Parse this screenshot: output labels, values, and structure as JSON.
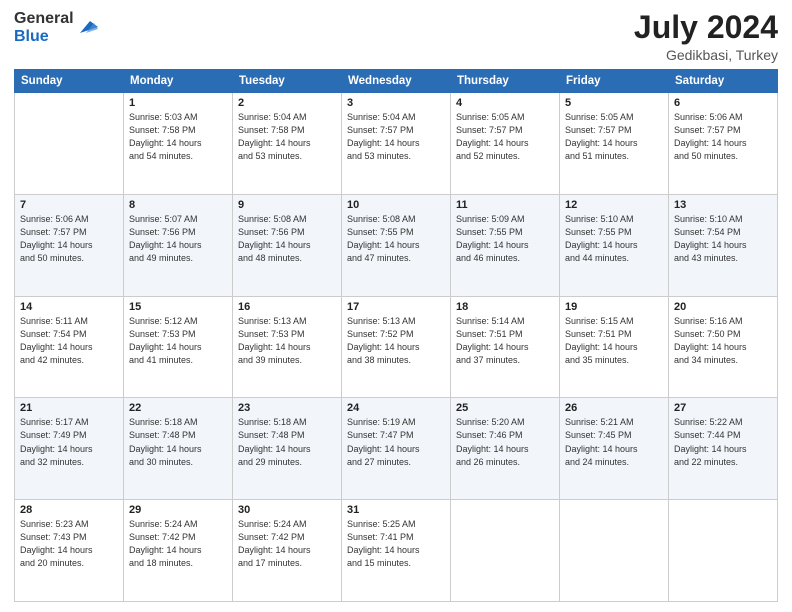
{
  "logo": {
    "general": "General",
    "blue": "Blue"
  },
  "header": {
    "month": "July 2024",
    "location": "Gedikbasi, Turkey"
  },
  "days": [
    "Sunday",
    "Monday",
    "Tuesday",
    "Wednesday",
    "Thursday",
    "Friday",
    "Saturday"
  ],
  "weeks": [
    [
      {
        "day": "",
        "info": ""
      },
      {
        "day": "1",
        "info": "Sunrise: 5:03 AM\nSunset: 7:58 PM\nDaylight: 14 hours\nand 54 minutes."
      },
      {
        "day": "2",
        "info": "Sunrise: 5:04 AM\nSunset: 7:58 PM\nDaylight: 14 hours\nand 53 minutes."
      },
      {
        "day": "3",
        "info": "Sunrise: 5:04 AM\nSunset: 7:57 PM\nDaylight: 14 hours\nand 53 minutes."
      },
      {
        "day": "4",
        "info": "Sunrise: 5:05 AM\nSunset: 7:57 PM\nDaylight: 14 hours\nand 52 minutes."
      },
      {
        "day": "5",
        "info": "Sunrise: 5:05 AM\nSunset: 7:57 PM\nDaylight: 14 hours\nand 51 minutes."
      },
      {
        "day": "6",
        "info": "Sunrise: 5:06 AM\nSunset: 7:57 PM\nDaylight: 14 hours\nand 50 minutes."
      }
    ],
    [
      {
        "day": "7",
        "info": "Sunrise: 5:06 AM\nSunset: 7:57 PM\nDaylight: 14 hours\nand 50 minutes."
      },
      {
        "day": "8",
        "info": "Sunrise: 5:07 AM\nSunset: 7:56 PM\nDaylight: 14 hours\nand 49 minutes."
      },
      {
        "day": "9",
        "info": "Sunrise: 5:08 AM\nSunset: 7:56 PM\nDaylight: 14 hours\nand 48 minutes."
      },
      {
        "day": "10",
        "info": "Sunrise: 5:08 AM\nSunset: 7:55 PM\nDaylight: 14 hours\nand 47 minutes."
      },
      {
        "day": "11",
        "info": "Sunrise: 5:09 AM\nSunset: 7:55 PM\nDaylight: 14 hours\nand 46 minutes."
      },
      {
        "day": "12",
        "info": "Sunrise: 5:10 AM\nSunset: 7:55 PM\nDaylight: 14 hours\nand 44 minutes."
      },
      {
        "day": "13",
        "info": "Sunrise: 5:10 AM\nSunset: 7:54 PM\nDaylight: 14 hours\nand 43 minutes."
      }
    ],
    [
      {
        "day": "14",
        "info": "Sunrise: 5:11 AM\nSunset: 7:54 PM\nDaylight: 14 hours\nand 42 minutes."
      },
      {
        "day": "15",
        "info": "Sunrise: 5:12 AM\nSunset: 7:53 PM\nDaylight: 14 hours\nand 41 minutes."
      },
      {
        "day": "16",
        "info": "Sunrise: 5:13 AM\nSunset: 7:53 PM\nDaylight: 14 hours\nand 39 minutes."
      },
      {
        "day": "17",
        "info": "Sunrise: 5:13 AM\nSunset: 7:52 PM\nDaylight: 14 hours\nand 38 minutes."
      },
      {
        "day": "18",
        "info": "Sunrise: 5:14 AM\nSunset: 7:51 PM\nDaylight: 14 hours\nand 37 minutes."
      },
      {
        "day": "19",
        "info": "Sunrise: 5:15 AM\nSunset: 7:51 PM\nDaylight: 14 hours\nand 35 minutes."
      },
      {
        "day": "20",
        "info": "Sunrise: 5:16 AM\nSunset: 7:50 PM\nDaylight: 14 hours\nand 34 minutes."
      }
    ],
    [
      {
        "day": "21",
        "info": "Sunrise: 5:17 AM\nSunset: 7:49 PM\nDaylight: 14 hours\nand 32 minutes."
      },
      {
        "day": "22",
        "info": "Sunrise: 5:18 AM\nSunset: 7:48 PM\nDaylight: 14 hours\nand 30 minutes."
      },
      {
        "day": "23",
        "info": "Sunrise: 5:18 AM\nSunset: 7:48 PM\nDaylight: 14 hours\nand 29 minutes."
      },
      {
        "day": "24",
        "info": "Sunrise: 5:19 AM\nSunset: 7:47 PM\nDaylight: 14 hours\nand 27 minutes."
      },
      {
        "day": "25",
        "info": "Sunrise: 5:20 AM\nSunset: 7:46 PM\nDaylight: 14 hours\nand 26 minutes."
      },
      {
        "day": "26",
        "info": "Sunrise: 5:21 AM\nSunset: 7:45 PM\nDaylight: 14 hours\nand 24 minutes."
      },
      {
        "day": "27",
        "info": "Sunrise: 5:22 AM\nSunset: 7:44 PM\nDaylight: 14 hours\nand 22 minutes."
      }
    ],
    [
      {
        "day": "28",
        "info": "Sunrise: 5:23 AM\nSunset: 7:43 PM\nDaylight: 14 hours\nand 20 minutes."
      },
      {
        "day": "29",
        "info": "Sunrise: 5:24 AM\nSunset: 7:42 PM\nDaylight: 14 hours\nand 18 minutes."
      },
      {
        "day": "30",
        "info": "Sunrise: 5:24 AM\nSunset: 7:42 PM\nDaylight: 14 hours\nand 17 minutes."
      },
      {
        "day": "31",
        "info": "Sunrise: 5:25 AM\nSunset: 7:41 PM\nDaylight: 14 hours\nand 15 minutes."
      },
      {
        "day": "",
        "info": ""
      },
      {
        "day": "",
        "info": ""
      },
      {
        "day": "",
        "info": ""
      }
    ]
  ]
}
